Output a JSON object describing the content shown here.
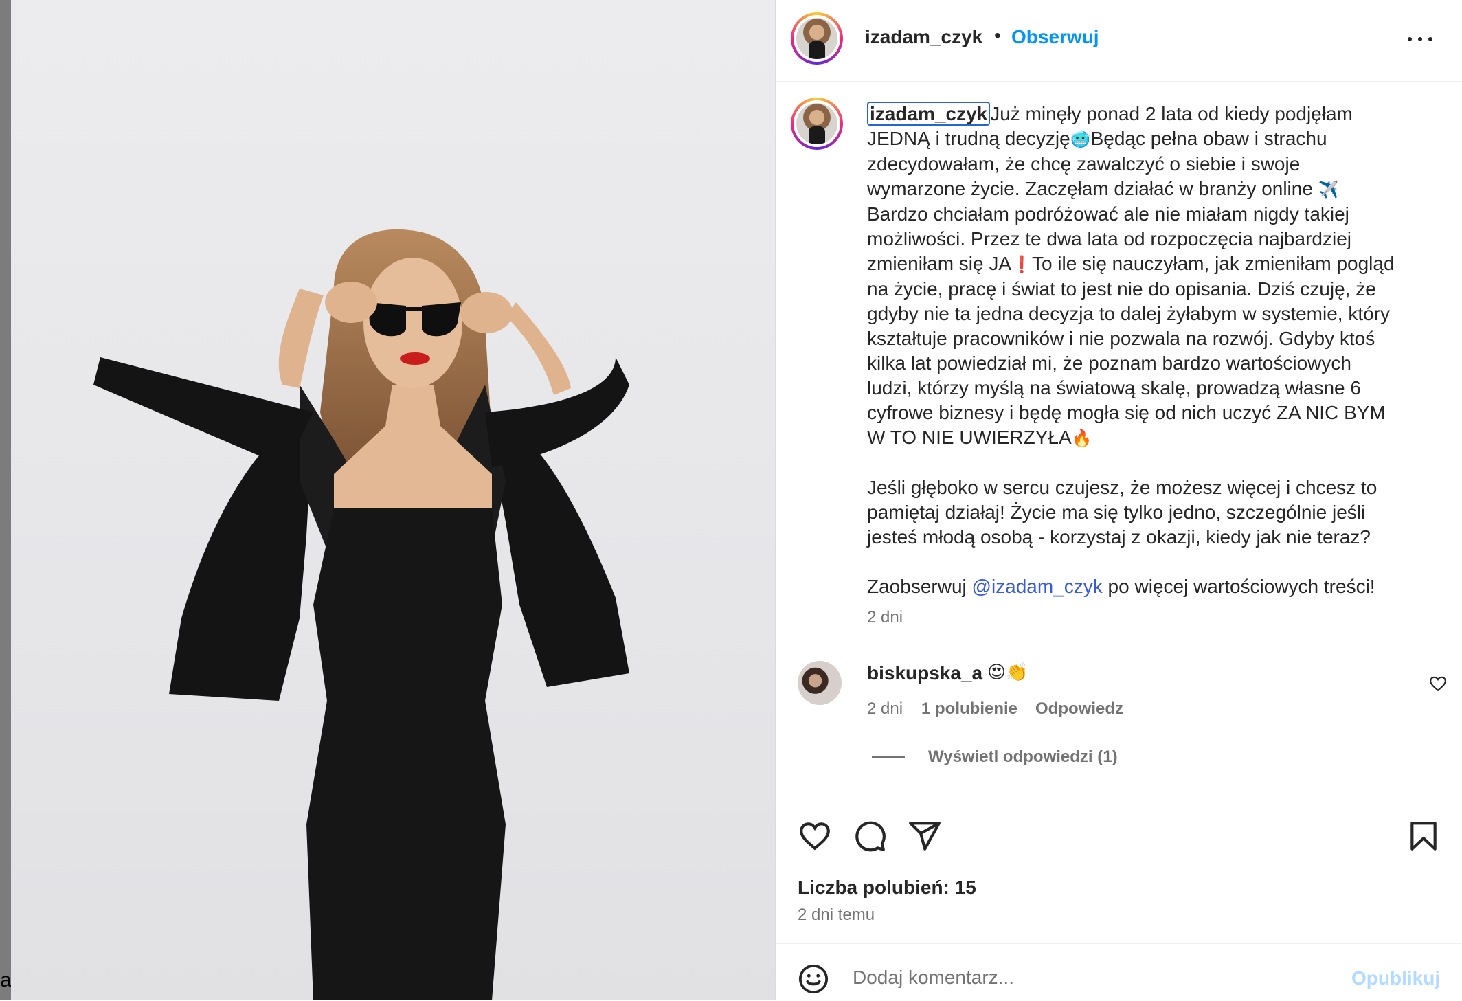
{
  "post": {
    "username": "izadam_czyk",
    "dot": "•",
    "follow_label": "Obserwuj",
    "more_icon": "more-horizontal-icon"
  },
  "caption": {
    "username": "izadam_czyk",
    "text_1": "Już minęły ponad 2 lata od kiedy podjęłam\nJEDNĄ i trudną decyzję",
    "emoji_1": "🥶",
    "text_2": "Będąc pełna obaw i strachu\nzdecydowałam, że chcę zawalczyć o siebie i swoje\nwymarzone życie. Zaczęłam działać w branży online ",
    "emoji_2": "✈️",
    "text_3": "\nBardzo chciałam podróżować ale nie miałam nigdy takiej\nmożliwości. Przez te dwa lata od rozpoczęcia najbardziej\nzmieniłam się JA",
    "emoji_3": "❗",
    "text_4": "To ile się nauczyłam, jak zmieniłam pogląd\nna życie, pracę i świat to jest nie do opisania. Dziś czuję, że\ngdyby nie ta jedna decyzja to dalej żyłabym w systemie, który\nkształtuje pracowników i nie pozwala na rozwój. Gdyby ktoś\nkilka lat powiedział mi, że poznam bardzo wartościowych\nludzi, którzy myślą na światową skalę, prowadzą własne 6\ncyfrowe biznesy i będę mogła się od nich uczyć ZA NIC BYM\nW TO NIE UWIERZYŁA",
    "emoji_4": "🔥",
    "text_5": "\n\nJeśli głęboko w sercu czujesz, że możesz więcej i chcesz to\npamiętaj działaj! Życie ma się tylko jedno, szczególnie jeśli\njesteś młodą osobą - korzystaj z okazji, kiedy jak nie teraz?\n\nZaobserwuj ",
    "mention": "@izadam_czyk",
    "text_6": " po więcej wartościowych treści!",
    "time": "2 dni"
  },
  "comment": {
    "username": "biskupska_a",
    "emojis": "😍👏",
    "time": "2 dni",
    "likes": "1 polubienie",
    "reply_label": "Odpowiedz",
    "view_replies": "Wyświetl odpowiedzi (1)"
  },
  "actions": {
    "icons": [
      "heart-icon",
      "comment-icon",
      "share-icon",
      "bookmark-icon"
    ]
  },
  "likes_label": "Liczba polubień: 15",
  "posted_ago": "2 dni temu",
  "add_comment": {
    "placeholder": "Dodaj komentarz...",
    "publish_label": "Opublikuj"
  },
  "left_edge_char": "a",
  "colors": {
    "follow": "#0095f6",
    "mention": "#385bd6",
    "publish_disabled": "#b3dbff",
    "secondary_text": "#737373"
  }
}
